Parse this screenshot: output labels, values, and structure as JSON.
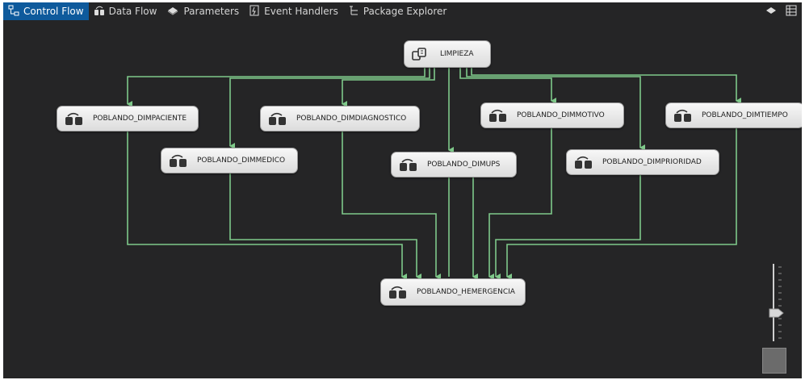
{
  "tabs": [
    {
      "label": "Control Flow",
      "icon": "control-flow-icon",
      "active": true
    },
    {
      "label": "Data Flow",
      "icon": "data-flow-icon",
      "active": false
    },
    {
      "label": "Parameters",
      "icon": "parameters-icon",
      "active": false
    },
    {
      "label": "Event Handlers",
      "icon": "event-handlers-icon",
      "active": false
    },
    {
      "label": "Package Explorer",
      "icon": "package-explorer-icon",
      "active": false
    }
  ],
  "right_icons": [
    "variables-icon",
    "grid-icon"
  ],
  "container": {
    "label": "LIMPIEZA",
    "icon": "sequence-container-icon"
  },
  "tasks": [
    {
      "label": "POBLANDO_DIMPACIENTE"
    },
    {
      "label": "POBLANDO_DIMMEDICO"
    },
    {
      "label": "POBLANDO_DIMDIAGNOSTICO"
    },
    {
      "label": "POBLANDO_DIMUPS"
    },
    {
      "label": "POBLANDO_DIMMOTIVO"
    },
    {
      "label": "POBLANDO_DIMPRIORIDAD"
    },
    {
      "label": "POBLANDO_DIMTIEMPO"
    }
  ],
  "final_task": {
    "label": "POBLANDO_HEMERGENCIA"
  },
  "colors": {
    "canvas": "#252526",
    "connector": "#7fc98a",
    "active_tab": "#0e5a9c"
  }
}
